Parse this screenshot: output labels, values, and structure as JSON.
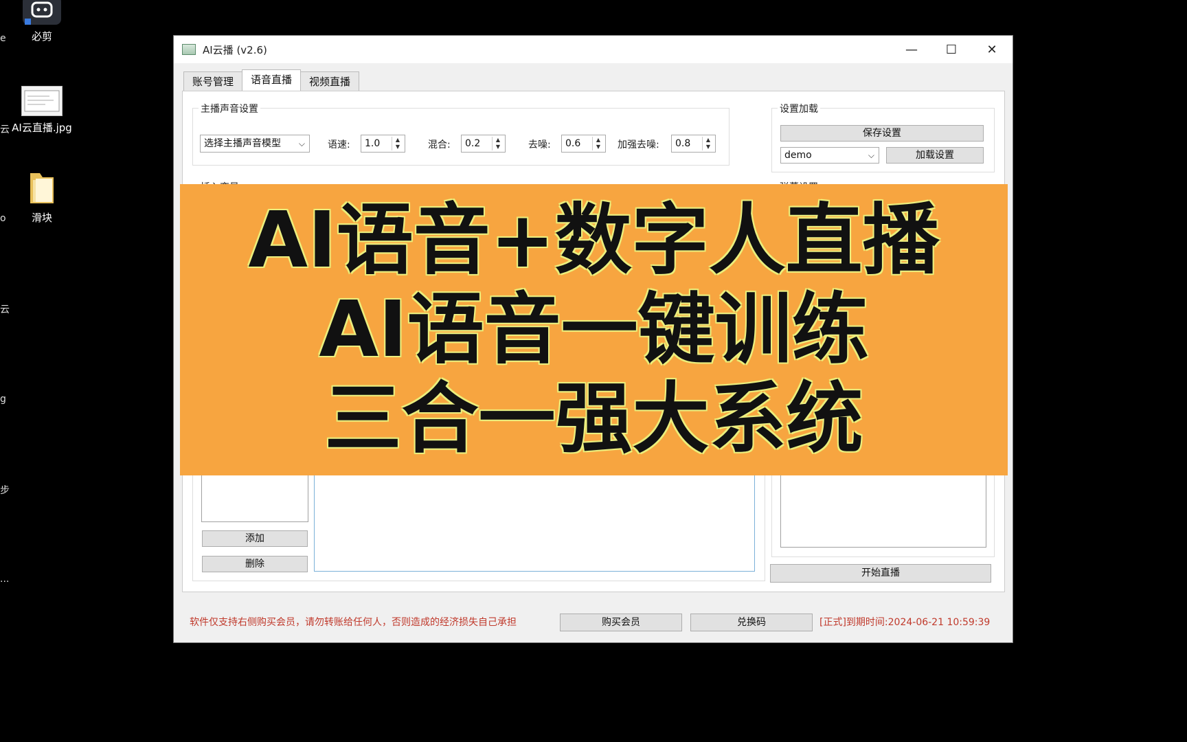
{
  "desktop": {
    "icons": [
      {
        "label": "必剪",
        "icon": "robot-app-icon"
      },
      {
        "label": "AI云直播.jpg",
        "icon": "image-file-icon"
      },
      {
        "label": "滑块",
        "icon": "folder-icon"
      }
    ],
    "edge_fragments": [
      "e",
      "云",
      "o",
      "云",
      "g",
      "步",
      "..."
    ]
  },
  "window": {
    "title": "AI云播 (v2.6)",
    "controls": {
      "minimize": "—",
      "maximize": "☐",
      "close": "✕"
    }
  },
  "tabs": [
    {
      "label": "账号管理",
      "active": false
    },
    {
      "label": "语音直播",
      "active": true
    },
    {
      "label": "视频直播",
      "active": false
    }
  ],
  "voice_settings": {
    "group_label": "主播声音设置",
    "model_select": "选择主播声音模型",
    "speed_label": "语速:",
    "speed_value": "1.0",
    "mix_label": "混合:",
    "mix_value": "0.2",
    "denoise_label": "去噪:",
    "denoise_value": "0.6",
    "strong_denoise_label": "加强去噪:",
    "strong_denoise_value": "0.8"
  },
  "settings_load": {
    "group_label": "设置加载",
    "save_button": "保存设置",
    "preset_select": "demo",
    "load_button": "加载设置"
  },
  "insert_vars": {
    "group_label": "插入变量",
    "add_button": "添加",
    "delete_button": "删除"
  },
  "danmaku": {
    "group_label": "弹幕设置",
    "start_button": "开始直播"
  },
  "footer": {
    "warning": "软件仅支持右侧购买会员，请勿转账给任何人，否则造成的经济损失自己承担",
    "buy_button": "购买会员",
    "redeem_button": "兑换码",
    "expiry": "[正式]到期时间:2024-06-21 10:59:39"
  },
  "banner": {
    "line1": "AI语音+数字人直播",
    "line2": "AI语音一键训练",
    "line3": "三合一强大系统",
    "background": "#f7a540"
  }
}
